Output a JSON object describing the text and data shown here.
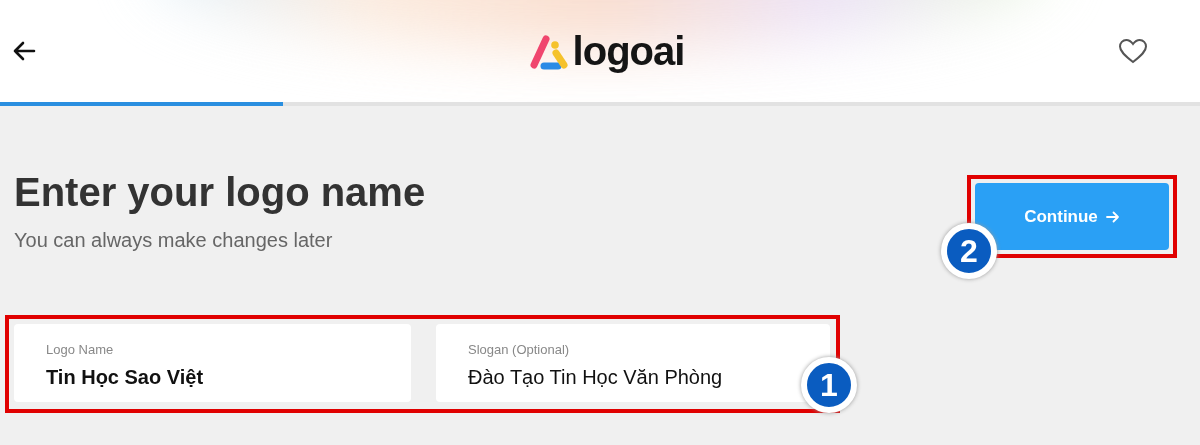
{
  "header": {
    "logo_text": "logoai"
  },
  "progress": {
    "level": 0.236
  },
  "heading": "Enter your logo name",
  "subtitle": "You can always make changes later",
  "continue_button": {
    "label": "Continue",
    "annotation": "2"
  },
  "fields": {
    "annotation": "1",
    "items": [
      {
        "kind": "name",
        "label": "Logo Name",
        "value": "Tin Học Sao Việt"
      },
      {
        "kind": "slogan",
        "label": "Slogan (Optional)",
        "value": "Đào Tạo Tin Học Văn Phòng"
      }
    ]
  }
}
